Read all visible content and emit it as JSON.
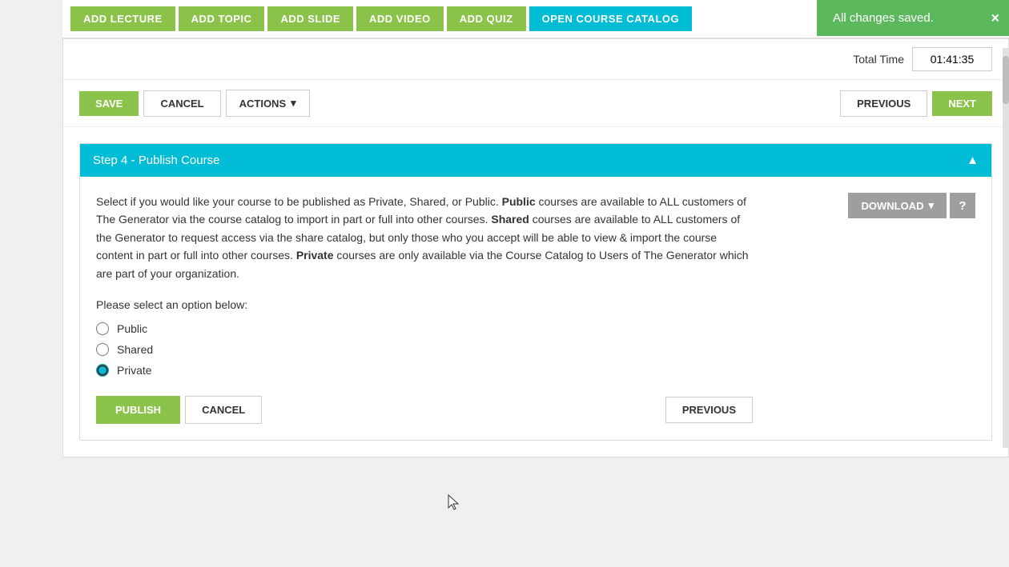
{
  "toast": {
    "message": "All changes saved.",
    "close_label": "×"
  },
  "toolbar": {
    "add_lecture": "ADD LECTURE",
    "add_topic": "ADD TOPIC",
    "add_slide": "ADD SLIDE",
    "add_video": "ADD VIDEO",
    "add_quiz": "ADD QUIZ",
    "open_course_catalog": "OPEN COURSE CATALOG"
  },
  "top_bar": {
    "total_time_label": "Total Time",
    "total_time_value": "01:41:35"
  },
  "action_bar": {
    "save_label": "SAVE",
    "cancel_label": "CANCEL",
    "actions_label": "ACTIONS",
    "previous_label": "PREVIOUS",
    "next_label": "NEXT"
  },
  "step_section": {
    "header": "Step 4 - Publish Course",
    "collapse_icon": "▲",
    "description_line1": "Select if you would like your course to be published as Private, Shared, or Public.",
    "description_public": "Public",
    "description_line2": " courses are available to ALL customers of The Generator via the course catalog to import in part or full into other courses.",
    "description_shared": "Shared",
    "description_line3": " courses are available to ALL customers of the Generator to request access via the share catalog, but only those who you accept will be able to view & import the course content in part or full into other courses.",
    "description_private": "Private",
    "description_line4": " courses are only available via the Course Catalog to Users of The Generator which are part of your organization.",
    "please_select": "Please select an option below:",
    "option_public": "Public",
    "option_shared": "Shared",
    "option_private": "Private",
    "download_label": "DOWNLOAD",
    "help_label": "?",
    "publish_label": "PUBLISH",
    "cancel_label": "CANCEL",
    "previous_label": "PREVIOUS"
  }
}
